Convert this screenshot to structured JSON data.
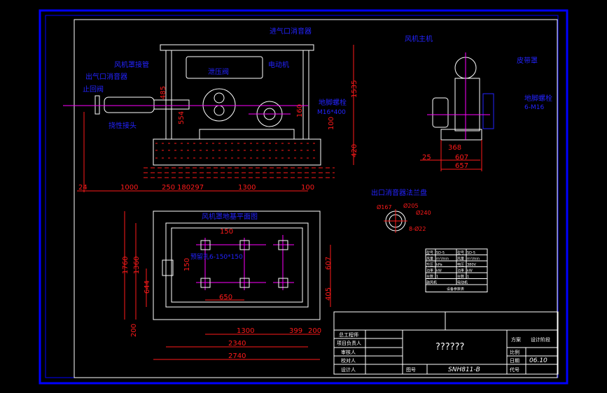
{
  "colors": {
    "background": "#000000",
    "frame": "#0000ff",
    "dimension": "#ff1a1a",
    "outline": "#ffffff",
    "centerline": "#ff00ff",
    "label": "#2323ff"
  },
  "elevation_view": {
    "labels": {
      "inlet_muffler": "进气口消音器",
      "motor": "电动机",
      "relief_valve": "泄压阀",
      "hood_pipe": "风机罩接管",
      "outlet_muffler": "出气口消音器",
      "check_valve": "止回阀",
      "flex_joint": "挠性接头",
      "anchor_bolt": "地脚螺栓",
      "anchor_spec": "M16*400"
    },
    "dims_bottom": [
      "24",
      "1000",
      "250",
      "180",
      "297",
      "1300",
      "100"
    ],
    "dims_vertical": {
      "total": "1535",
      "base": "420",
      "d100": "100",
      "d160": "160",
      "d554": "554",
      "d485": "485"
    }
  },
  "side_view": {
    "labels": {
      "blower": "风机主机",
      "belt_guard": "皮带罩",
      "anchor_bolt": "地脚螺栓",
      "anchor_spec": "6-M16"
    },
    "dims": {
      "d368": "368",
      "d607": "607",
      "d657": "657",
      "d25": "25"
    }
  },
  "flange": {
    "title": "出口消音器法兰盘",
    "d1": "Ø167",
    "d2": "Ø205",
    "d3": "Ø240",
    "holes": "8-Ø22"
  },
  "spec_table": {
    "rows": [
      [
        "型号",
        "SD-5",
        "型号",
        "SD-5"
      ],
      [
        "风量",
        "m³/min",
        "风量",
        "m³/min"
      ],
      [
        "升压",
        "kPa",
        "电压",
        "380V"
      ],
      [
        "功率",
        "kW",
        "功率",
        "kW"
      ],
      [
        "台数",
        "1",
        "台数",
        "1"
      ],
      [
        "鼓风机",
        "",
        "电动机",
        ""
      ]
    ],
    "footer": "设备参数表"
  },
  "plan_view": {
    "title": "风机罩地基平面图",
    "hole_note": "预留孔6-150*150",
    "dims": {
      "d150_h": "150",
      "d150_v": "150",
      "d650": "650",
      "d1760": "1760",
      "d1360": "1360",
      "d644": "644",
      "d200_v": "200",
      "d607": "607",
      "d405": "405",
      "d1300": "1300",
      "d399": "399",
      "d200_h": "200",
      "d2340": "2340",
      "d2740": "2740"
    }
  },
  "title_block": {
    "roles": [
      "总工程师",
      "项目负责人",
      "审核人",
      "校对人",
      "设计人"
    ],
    "drawing_title": "??????",
    "drawing_no_label": "图号",
    "drawing_no": "SNH811-B",
    "scheme": "方案",
    "stage": "设计阶段",
    "scale_label": "比例",
    "date_label": "日期",
    "date": "06.10",
    "code_label": "代号"
  }
}
